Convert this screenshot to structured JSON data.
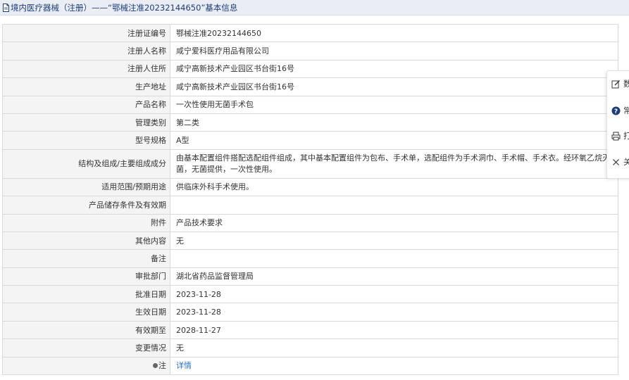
{
  "header": {
    "title": "境内医疗器械（注册）——“鄂械注准20232144650”基本信息"
  },
  "rows": [
    {
      "label": "注册证编号",
      "value": "鄂械注准20232144650"
    },
    {
      "label": "注册人名称",
      "value": "咸宁爱科医疗用品有限公司"
    },
    {
      "label": "注册人住所",
      "value": "咸宁高新技术产业园区书台街16号"
    },
    {
      "label": "生产地址",
      "value": "咸宁高新技术产业园区书台街16号"
    },
    {
      "label": "产品名称",
      "value": "一次性使用无菌手术包"
    },
    {
      "label": "管理类别",
      "value": "第二类"
    },
    {
      "label": "型号规格",
      "value": "A型"
    },
    {
      "label": "结构及组成/主要组成成分",
      "value": "由基本配置组件搭配选配组件组成，其中基本配置组件为包布、手术单，选配组件为手术洞巾、手术帽、手术衣。经环氧乙烷灭菌，无菌提供，一次性使用。"
    },
    {
      "label": "适用范围/预期用途",
      "value": "供临床外科手术使用。"
    },
    {
      "label": "产品储存条件及有效期",
      "value": ""
    },
    {
      "label": "附件",
      "value": "产品技术要求"
    },
    {
      "label": "其他内容",
      "value": "无"
    },
    {
      "label": "备注",
      "value": ""
    },
    {
      "label": "审批部门",
      "value": "湖北省药品监督管理局"
    },
    {
      "label": "批准日期",
      "value": "2023-11-28"
    },
    {
      "label": "生效日期",
      "value": "2023-11-28"
    },
    {
      "label": "有效期至",
      "value": "2028-11-27"
    },
    {
      "label": "变更情况",
      "value": "无"
    },
    {
      "label": "注",
      "value": "详情"
    }
  ],
  "sidebar": {
    "items": [
      {
        "label": "数",
        "icon": "edit-icon"
      },
      {
        "label": "常",
        "icon": "help-icon"
      },
      {
        "label": "打",
        "icon": "printer-icon"
      },
      {
        "label": "关",
        "icon": "close-icon"
      }
    ]
  },
  "colors": {
    "title_text": "#1e3c78",
    "title_bg": "#eaeef4",
    "label_bg": "#f4f4f4",
    "link": "#2a73c6",
    "border": "#d9d9d9"
  }
}
